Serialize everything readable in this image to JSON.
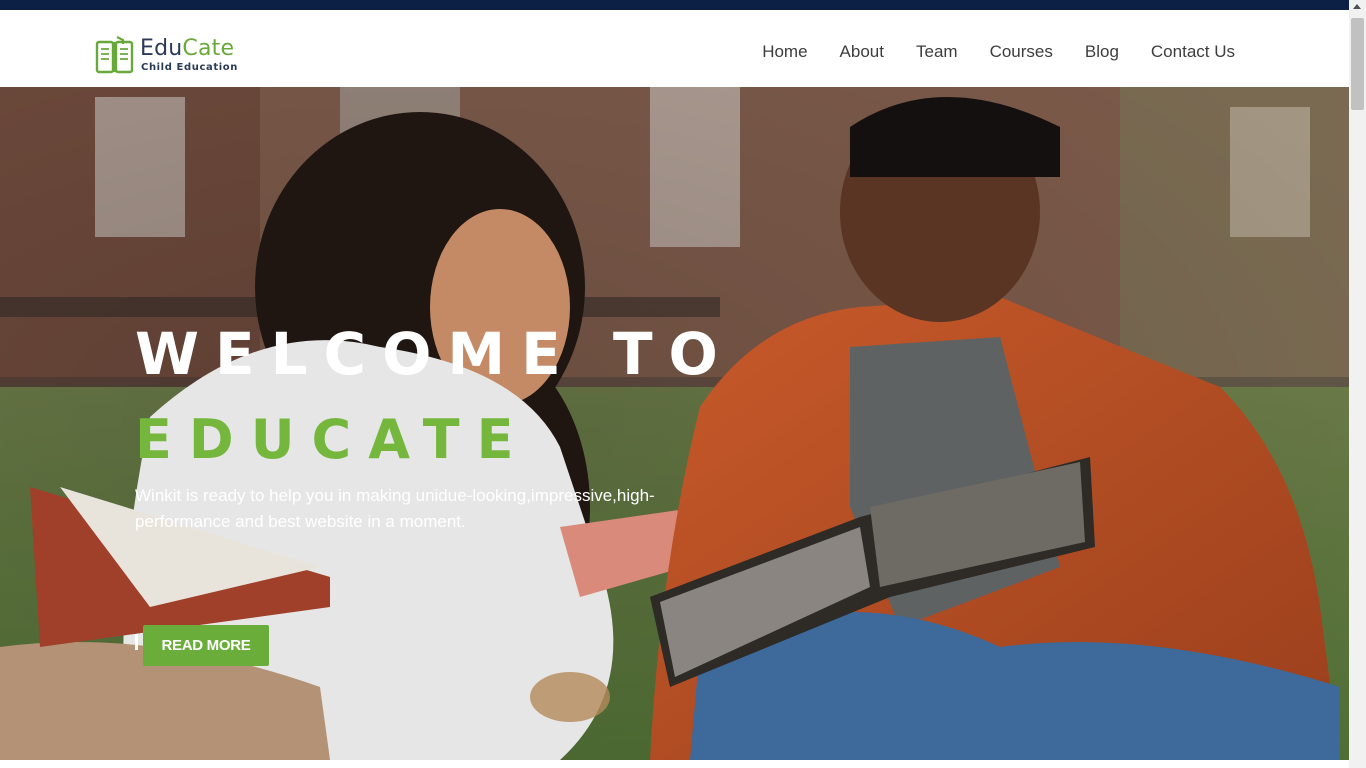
{
  "brand": {
    "name_part1": "Edu",
    "name_part2": "Cate",
    "tagline": "Child Education"
  },
  "nav": {
    "items": [
      "Home",
      "About",
      "Team",
      "Courses",
      "Blog",
      "Contact Us"
    ]
  },
  "hero": {
    "title_line1": "WELCOME TO",
    "title_line2": "EDUCATE",
    "description": "Winkit is ready to help you in making unidue-looking,impressive,high-performance and best website in a moment.",
    "button_label": "READ MORE"
  },
  "colors": {
    "accent_green": "#75b73c",
    "button_green": "#6aad3a",
    "navy": "#0c1f45",
    "brand_text": "#2b3b57"
  }
}
